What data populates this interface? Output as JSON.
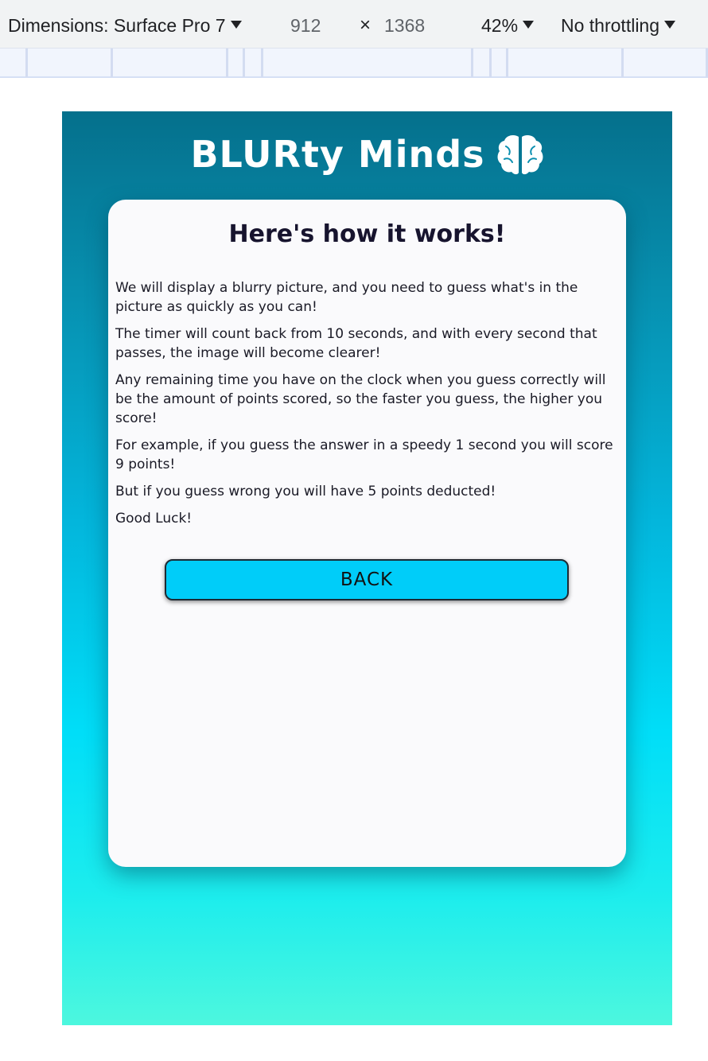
{
  "devtools": {
    "dimensions_label": "Dimensions: Surface Pro 7",
    "width": "912",
    "times": "×",
    "height": "1368",
    "zoom": "42%",
    "throttling": "No throttling"
  },
  "app": {
    "brand_title": "BLURty Minds",
    "brand_icon": "brain-icon",
    "colors": {
      "gradient_top": "#05708c",
      "gradient_mid": "#00def8",
      "gradient_bottom": "#4df7de",
      "button": "#00cdf9",
      "card": "#fafafc"
    }
  },
  "instructions": {
    "title": "Here's how it works!",
    "paragraphs": [
      "We will display a blurry picture, and you need to guess what's in the picture as quickly as you can!",
      "The timer will count back from 10 seconds, and with every second that passes, the image will become clearer!",
      "Any remaining time you have on the clock when you guess correctly will be the amount of points scored, so the faster you guess, the higher you score!",
      "For example, if you guess the answer in a speedy 1 second you will score 9 points!",
      "But if you guess wrong you will have 5 points deducted!",
      "Good Luck!"
    ],
    "back_label": "BACK"
  }
}
